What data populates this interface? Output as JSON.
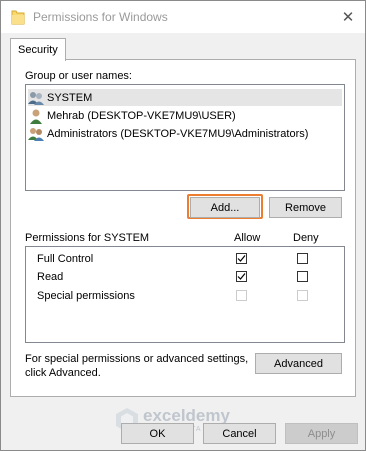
{
  "window": {
    "title": "Permissions for Windows"
  },
  "tabs": [
    {
      "label": "Security",
      "active": true
    }
  ],
  "security": {
    "group_label": "Group or user names:",
    "users": [
      {
        "name": "SYSTEM",
        "icon": "users-group-icon",
        "selected": true
      },
      {
        "name": "Mehrab (DESKTOP-VKE7MU9\\USER)",
        "icon": "user-icon",
        "selected": false
      },
      {
        "name": "Administrators (DESKTOP-VKE7MU9\\Administrators)",
        "icon": "users-group-icon",
        "selected": false
      }
    ],
    "add_label": "Add...",
    "remove_label": "Remove",
    "permissions_label": "Permissions for SYSTEM",
    "allow_label": "Allow",
    "deny_label": "Deny",
    "permissions": [
      {
        "name": "Full Control",
        "allow": true,
        "deny": false,
        "enabled": true
      },
      {
        "name": "Read",
        "allow": true,
        "deny": false,
        "enabled": true
      },
      {
        "name": "Special permissions",
        "allow": false,
        "deny": false,
        "enabled": false
      }
    ],
    "advanced_text_line1": "For special permissions or advanced settings,",
    "advanced_text_line2": "click Advanced.",
    "advanced_label": "Advanced"
  },
  "footer": {
    "ok_label": "OK",
    "cancel_label": "Cancel",
    "apply_label": "Apply"
  },
  "watermark": {
    "brand": "exceldemy",
    "tagline": "EXCEL · DATA · BI"
  },
  "colors": {
    "highlight": "#ed7d31",
    "selection": "#e5e5e5"
  }
}
